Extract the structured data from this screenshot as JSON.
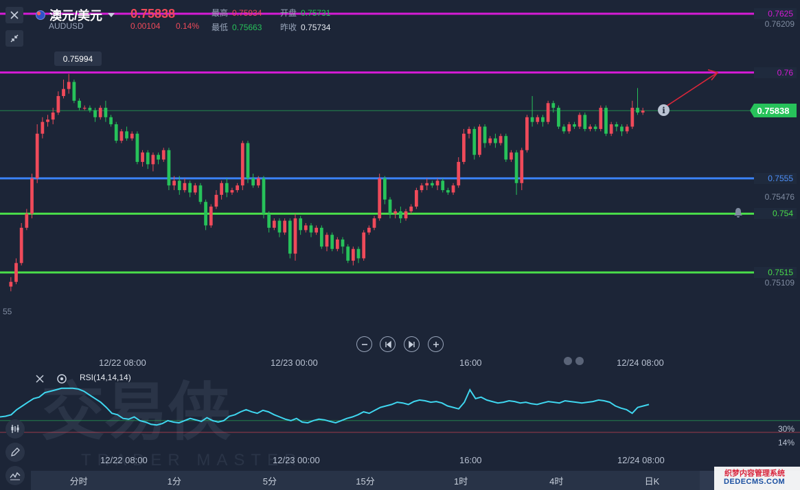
{
  "header": {
    "symbol_name": "澳元/美元",
    "symbol_code": "AUDUSD",
    "last_price": "0.75838",
    "change": "0.00104",
    "change_pct": "0.14%",
    "stats": {
      "high_label": "最高",
      "high_value": "0.75934",
      "open_label": "开盘",
      "open_value": "0.75731",
      "low_label": "最低",
      "low_value": "0.75663",
      "prev_close_label": "昨收",
      "prev_close_value": "0.75734"
    }
  },
  "icons": {
    "close": "close-icon",
    "collapse": "collapse-arrows-icon",
    "flag": "australia-flag-icon",
    "dropdown": "chevron-down-icon",
    "bell": "bell-icon",
    "info": "info-icon"
  },
  "colors": {
    "background": "#1c2537",
    "up_candle": "#ef4a5a",
    "down_candle": "#27c25a",
    "magenta_line": "#d61bd6",
    "blue_line": "#3b82f6",
    "green_line": "#4ade4a",
    "rsi_line": "#3fd7f0",
    "current_price": "#27c25a"
  },
  "price_axis": {
    "labels": [
      "0.76209",
      "0.75476",
      "0.75109"
    ],
    "left_fragment": "55"
  },
  "levels": [
    {
      "value": 0.7625,
      "label": "0.7625",
      "color": "#d61bd6"
    },
    {
      "value": 0.76,
      "label": "0.76",
      "color": "#d61bd6"
    },
    {
      "value": 0.7555,
      "label": "0.7555",
      "color": "#3b82f6"
    },
    {
      "value": 0.754,
      "label": "0.754",
      "color": "#4ade4a"
    },
    {
      "value": 0.7515,
      "label": "0.7515",
      "color": "#4ade4a"
    }
  ],
  "current_price_tag": "0.75838",
  "high_tooltip": "0.75994",
  "main_time_labels": [
    "12/22 08:00",
    "12/23 00:00",
    "16:00",
    "12/24 08:00"
  ],
  "rsi": {
    "name": "RSI(14,14,14)",
    "level_labels": [
      "30%",
      "14%"
    ],
    "time_labels": [
      "12/22 08:00",
      "12/23 00:00",
      "16:00",
      "12/24 08:00"
    ]
  },
  "timeframes": [
    "分时",
    "1分",
    "5分",
    "15分",
    "1时",
    "4时",
    "日K"
  ],
  "watermark": {
    "logo_text": "交易侠",
    "logo_sub": "TRADER MASTER",
    "site_line1": "织梦内容管理系统",
    "site_line2": "DEDECMS.COM"
  },
  "chart_data": {
    "type": "candlestick",
    "symbol": "AUDUSD",
    "ylim": [
      0.7507,
      0.763
    ],
    "x_tick_labels": [
      "12/22 08:00",
      "12/23 00:00",
      "16:00",
      "12/24 08:00"
    ],
    "candles": [
      [
        0.7509,
        0.7511,
        0.7507,
        0.7513
      ],
      [
        0.7511,
        0.7519,
        0.751,
        0.7521
      ],
      [
        0.7519,
        0.7534,
        0.7518,
        0.7536
      ],
      [
        0.7534,
        0.754,
        0.7533,
        0.7542
      ],
      [
        0.754,
        0.7555,
        0.7538,
        0.7557
      ],
      [
        0.7555,
        0.7574,
        0.7553,
        0.7578
      ],
      [
        0.7574,
        0.7579,
        0.7572,
        0.7581
      ],
      [
        0.7579,
        0.758,
        0.7577,
        0.7582
      ],
      [
        0.758,
        0.7583,
        0.7578,
        0.7585
      ],
      [
        0.7583,
        0.759,
        0.7582,
        0.7592
      ],
      [
        0.759,
        0.7593,
        0.7589,
        0.7597
      ],
      [
        0.7593,
        0.7596,
        0.7591,
        0.75994
      ],
      [
        0.7596,
        0.7588,
        0.7587,
        0.7597
      ],
      [
        0.7588,
        0.7585,
        0.7584,
        0.7589
      ],
      [
        0.7585,
        0.7585,
        0.7584,
        0.7586
      ],
      [
        0.7585,
        0.7584,
        0.7583,
        0.7586
      ],
      [
        0.7584,
        0.7581,
        0.7579,
        0.7585
      ],
      [
        0.7581,
        0.7585,
        0.758,
        0.7586
      ],
      [
        0.7585,
        0.7581,
        0.7579,
        0.7588
      ],
      [
        0.7581,
        0.7578,
        0.7577,
        0.7582
      ],
      [
        0.7578,
        0.7571,
        0.757,
        0.7579
      ],
      [
        0.7571,
        0.7575,
        0.757,
        0.7576
      ],
      [
        0.7575,
        0.7572,
        0.7571,
        0.7577
      ],
      [
        0.7572,
        0.7574,
        0.7571,
        0.7575
      ],
      [
        0.7574,
        0.7562,
        0.7561,
        0.7575
      ],
      [
        0.7562,
        0.7566,
        0.756,
        0.7567
      ],
      [
        0.7566,
        0.7561,
        0.7559,
        0.7567
      ],
      [
        0.7561,
        0.7565,
        0.7558,
        0.7566
      ],
      [
        0.7565,
        0.7563,
        0.7561,
        0.7566
      ],
      [
        0.7563,
        0.7567,
        0.7562,
        0.7568
      ],
      [
        0.7567,
        0.7552,
        0.755,
        0.7568
      ],
      [
        0.7552,
        0.7554,
        0.755,
        0.7556
      ],
      [
        0.7554,
        0.755,
        0.7548,
        0.7556
      ],
      [
        0.755,
        0.7553,
        0.7549,
        0.7555
      ],
      [
        0.7553,
        0.7549,
        0.7547,
        0.7554
      ],
      [
        0.7549,
        0.7552,
        0.7548,
        0.7553
      ],
      [
        0.7552,
        0.7545,
        0.7544,
        0.7553
      ],
      [
        0.7545,
        0.7535,
        0.7533,
        0.7546
      ],
      [
        0.7535,
        0.7543,
        0.7534,
        0.7544
      ],
      [
        0.7543,
        0.7548,
        0.7542,
        0.755
      ],
      [
        0.7548,
        0.7553,
        0.7546,
        0.7554
      ],
      [
        0.7553,
        0.7549,
        0.7547,
        0.7555
      ],
      [
        0.7549,
        0.755,
        0.7548,
        0.7551
      ],
      [
        0.755,
        0.7552,
        0.7549,
        0.7553
      ],
      [
        0.7552,
        0.757,
        0.755,
        0.7571
      ],
      [
        0.757,
        0.7555,
        0.7553,
        0.7571
      ],
      [
        0.7555,
        0.7552,
        0.7551,
        0.7557
      ],
      [
        0.7552,
        0.7555,
        0.7551,
        0.7556
      ],
      [
        0.7555,
        0.754,
        0.7538,
        0.7556
      ],
      [
        0.754,
        0.7534,
        0.7532,
        0.7541
      ],
      [
        0.7534,
        0.7537,
        0.7533,
        0.7538
      ],
      [
        0.7537,
        0.7532,
        0.753,
        0.7538
      ],
      [
        0.7532,
        0.7537,
        0.7531,
        0.7538
      ],
      [
        0.7537,
        0.7523,
        0.7521,
        0.7538
      ],
      [
        0.7523,
        0.7538,
        0.752,
        0.754
      ],
      [
        0.7538,
        0.7533,
        0.7531,
        0.7539
      ],
      [
        0.7533,
        0.7535,
        0.7532,
        0.7536
      ],
      [
        0.7535,
        0.7532,
        0.753,
        0.7536
      ],
      [
        0.7532,
        0.7534,
        0.7531,
        0.7535
      ],
      [
        0.7534,
        0.7526,
        0.7525,
        0.7535
      ],
      [
        0.7526,
        0.7531,
        0.7524,
        0.7532
      ],
      [
        0.7531,
        0.7525,
        0.7524,
        0.7532
      ],
      [
        0.7525,
        0.7529,
        0.7524,
        0.753
      ],
      [
        0.7529,
        0.7526,
        0.7523,
        0.753
      ],
      [
        0.7526,
        0.752,
        0.7519,
        0.7527
      ],
      [
        0.752,
        0.7525,
        0.7518,
        0.7526
      ],
      [
        0.7525,
        0.7521,
        0.7519,
        0.7526
      ],
      [
        0.7521,
        0.7532,
        0.752,
        0.7533
      ],
      [
        0.7532,
        0.7534,
        0.7531,
        0.7535
      ],
      [
        0.7534,
        0.7538,
        0.7533,
        0.7539
      ],
      [
        0.7538,
        0.7555,
        0.7537,
        0.7557
      ],
      [
        0.7555,
        0.7546,
        0.7544,
        0.7556
      ],
      [
        0.7546,
        0.754,
        0.7538,
        0.7547
      ],
      [
        0.754,
        0.7541,
        0.7538,
        0.7542
      ],
      [
        0.7541,
        0.7538,
        0.7536,
        0.7543
      ],
      [
        0.7538,
        0.7541,
        0.7537,
        0.7542
      ],
      [
        0.7541,
        0.7543,
        0.754,
        0.7544
      ],
      [
        0.7543,
        0.755,
        0.7542,
        0.7551
      ],
      [
        0.755,
        0.7552,
        0.7549,
        0.7553
      ],
      [
        0.7552,
        0.7553,
        0.755,
        0.7555
      ],
      [
        0.7553,
        0.7552,
        0.7551,
        0.7554
      ],
      [
        0.7552,
        0.7554,
        0.755,
        0.7555
      ],
      [
        0.7554,
        0.755,
        0.7549,
        0.7555
      ],
      [
        0.755,
        0.7549,
        0.7548,
        0.7551
      ],
      [
        0.7549,
        0.7552,
        0.7548,
        0.7553
      ],
      [
        0.7552,
        0.7562,
        0.7551,
        0.7564
      ],
      [
        0.7562,
        0.7574,
        0.7561,
        0.7576
      ],
      [
        0.7574,
        0.7576,
        0.7572,
        0.7577
      ],
      [
        0.7576,
        0.7565,
        0.7563,
        0.7577
      ],
      [
        0.7565,
        0.7577,
        0.7564,
        0.7578
      ],
      [
        0.7577,
        0.757,
        0.7568,
        0.7578
      ],
      [
        0.757,
        0.7572,
        0.7569,
        0.7573
      ],
      [
        0.7572,
        0.757,
        0.7568,
        0.7574
      ],
      [
        0.757,
        0.7573,
        0.7569,
        0.7574
      ],
      [
        0.7573,
        0.7563,
        0.7562,
        0.7574
      ],
      [
        0.7563,
        0.7566,
        0.7562,
        0.7567
      ],
      [
        0.7566,
        0.7553,
        0.7548,
        0.7567
      ],
      [
        0.7553,
        0.7567,
        0.755,
        0.7568
      ],
      [
        0.7567,
        0.7581,
        0.7566,
        0.7582
      ],
      [
        0.7581,
        0.7579,
        0.7577,
        0.759
      ],
      [
        0.7579,
        0.7581,
        0.7578,
        0.7582
      ],
      [
        0.7581,
        0.7579,
        0.7577,
        0.7582
      ],
      [
        0.7579,
        0.7587,
        0.7578,
        0.7588
      ],
      [
        0.7587,
        0.7585,
        0.7583,
        0.7588
      ],
      [
        0.7585,
        0.7577,
        0.7576,
        0.7586
      ],
      [
        0.7577,
        0.7575,
        0.7574,
        0.7578
      ],
      [
        0.7575,
        0.7578,
        0.7574,
        0.7579
      ],
      [
        0.7578,
        0.7577,
        0.7576,
        0.7579
      ],
      [
        0.7577,
        0.7582,
        0.7576,
        0.7583
      ],
      [
        0.7582,
        0.7576,
        0.7575,
        0.7583
      ],
      [
        0.7576,
        0.7577,
        0.7575,
        0.7578
      ],
      [
        0.7577,
        0.7576,
        0.7575,
        0.7578
      ],
      [
        0.7576,
        0.7585,
        0.7575,
        0.7586
      ],
      [
        0.7585,
        0.7574,
        0.7573,
        0.7586
      ],
      [
        0.7574,
        0.7578,
        0.7573,
        0.7579
      ],
      [
        0.7578,
        0.7577,
        0.7575,
        0.7579
      ],
      [
        0.7577,
        0.7575,
        0.7573,
        0.7578
      ],
      [
        0.7575,
        0.7577,
        0.7574,
        0.7578
      ],
      [
        0.7577,
        0.7585,
        0.7576,
        0.7588
      ],
      [
        0.7585,
        0.7583,
        0.7582,
        0.75934
      ],
      [
        0.7583,
        0.75838,
        0.7582,
        0.7585
      ]
    ],
    "current_price": 0.75838,
    "rsi": {
      "name": "RSI(14,14,14)",
      "ylim": [
        0,
        100
      ],
      "reference_levels": [
        30,
        14
      ],
      "values": [
        35,
        36,
        38,
        45,
        50,
        55,
        60,
        62,
        68,
        70,
        72,
        74,
        74,
        74,
        73,
        70,
        65,
        60,
        55,
        48,
        40,
        38,
        33,
        32,
        35,
        30,
        28,
        25,
        24,
        26,
        30,
        28,
        27,
        30,
        33,
        31,
        29,
        34,
        30,
        28,
        30,
        36,
        38,
        42,
        45,
        42,
        40,
        44,
        42,
        38,
        35,
        32,
        30,
        33,
        28,
        27,
        30,
        32,
        31,
        29,
        27,
        30,
        33,
        35,
        38,
        42,
        40,
        44,
        48,
        50,
        52,
        55,
        54,
        52,
        56,
        58,
        57,
        55,
        56,
        54,
        50,
        48,
        46,
        55,
        72,
        60,
        62,
        58,
        56,
        54,
        55,
        57,
        56,
        54,
        55,
        53,
        52,
        54,
        56,
        55,
        54,
        57,
        56,
        55,
        54,
        55,
        56,
        58,
        57,
        55,
        50,
        47,
        45,
        40,
        48,
        50,
        52
      ]
    }
  }
}
